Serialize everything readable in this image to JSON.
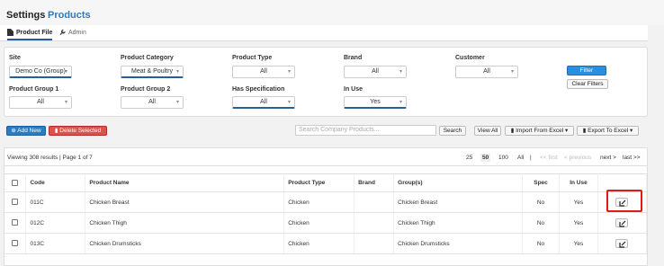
{
  "header": {
    "title": "Settings",
    "section": "Products"
  },
  "tabs": [
    {
      "label": "Product File",
      "icon": "file-icon",
      "active": true
    },
    {
      "label": "Admin",
      "icon": "wrench-icon",
      "active": false
    }
  ],
  "filters": {
    "site": {
      "label": "Site",
      "value": "Demo Co (Group)"
    },
    "product_category": {
      "label": "Product Category",
      "value": "Meat & Poultry"
    },
    "product_type": {
      "label": "Product Type",
      "value": "All"
    },
    "brand": {
      "label": "Brand",
      "value": "All"
    },
    "customer": {
      "label": "Customer",
      "value": "All"
    },
    "product_group_1": {
      "label": "Product Group 1",
      "value": "All"
    },
    "product_group_2": {
      "label": "Product Group 2",
      "value": "All"
    },
    "has_specification": {
      "label": "Has Specification",
      "value": "All"
    },
    "in_use": {
      "label": "In Use",
      "value": "Yes"
    },
    "filter_button": "Filter",
    "clear_button": "Clear Filters"
  },
  "toolbar": {
    "add_label": "Add New",
    "delete_label": "Delete Selected",
    "search_placeholder": "Search Company Products...",
    "search_label": "Search",
    "view_all_label": "View All",
    "import_label": "Import From Excel",
    "export_label": "Export To Excel"
  },
  "pager": {
    "info": "Viewing 308 results | Page 1 of 7",
    "sizes": [
      "25",
      "50",
      "100",
      "All"
    ],
    "selected_size": "50",
    "sep": "|",
    "first": "<< first",
    "previous": "< previous",
    "next": "next >",
    "last": "last >>"
  },
  "table": {
    "columns": [
      "Code",
      "Product Name",
      "Product Type",
      "Brand",
      "Group(s)",
      "Spec",
      "In Use"
    ],
    "rows": [
      {
        "code": "011C",
        "name": "Chicken Breast",
        "type": "Chicken",
        "brand": "",
        "groups": "Chicken Breast",
        "spec": "No",
        "in_use": "Yes"
      },
      {
        "code": "012C",
        "name": "Chicken Thigh",
        "type": "Chicken",
        "brand": "",
        "groups": "Chicken Thigh",
        "spec": "No",
        "in_use": "Yes"
      },
      {
        "code": "013C",
        "name": "Chicken Drumsticks",
        "type": "Chicken",
        "brand": "",
        "groups": "Chicken Drumsticks",
        "spec": "No",
        "in_use": "Yes"
      }
    ]
  },
  "colors": {
    "accent": "#2b7bc0",
    "danger": "#d9534f",
    "highlight": "#e01a1a"
  }
}
